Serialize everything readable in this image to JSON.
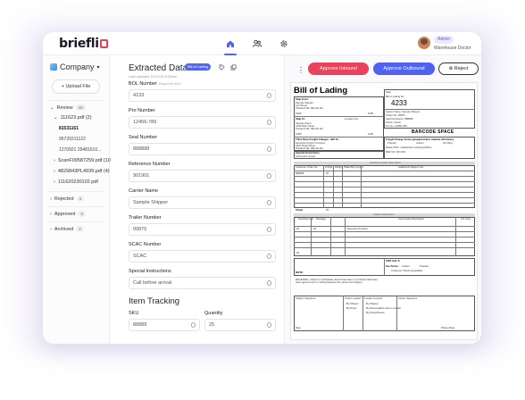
{
  "app": {
    "logo": "briefli",
    "user": {
      "role": "Admin",
      "name": "Warehouse Doctor"
    },
    "nav": {
      "home_icon": "home-icon",
      "users_icon": "users-icon",
      "settings_icon": "gear-icon"
    }
  },
  "sidebar": {
    "company": "Company",
    "upload_label": "+ Upload File",
    "review": {
      "label": "Review",
      "count": "10"
    },
    "review_items": [
      {
        "label": "111623.pdf (2)"
      },
      {
        "label": "81531161"
      },
      {
        "label": "95720211122"
      },
      {
        "label": "1270921 29481610..."
      },
      {
        "label": "ScanF09587259.pdf (10)"
      },
      {
        "label": "4829843PL4939.pdf (4)"
      },
      {
        "label": "111620230102.pdf"
      }
    ],
    "rejected": {
      "label": "Rejected",
      "count": "4"
    },
    "approved": {
      "label": "Approved",
      "count": "3"
    },
    "archived": {
      "label": "Archived",
      "count": "0"
    }
  },
  "form": {
    "title": "Extracted Data",
    "badge": "Bill of Lading",
    "subtitle": "Last updated 11/12/23 8:35am",
    "fields": [
      {
        "label": "BOL Number",
        "hint": "Required field",
        "value": "4233"
      },
      {
        "label": "Pro Number",
        "hint": "",
        "value": "12456-789"
      },
      {
        "label": "Seal Number",
        "hint": "",
        "value": "888888"
      },
      {
        "label": "Reference Number",
        "hint": "",
        "value": "901901"
      },
      {
        "label": "Carrier Name",
        "hint": "",
        "value": "Sample Shipper"
      },
      {
        "label": "Trailer Number",
        "hint": "",
        "value": "09875"
      },
      {
        "label": "SCAC Number",
        "hint": "",
        "value": "SCAC"
      },
      {
        "label": "Special Instructions",
        "hint": "",
        "value": "Call before arrival"
      }
    ],
    "item_tracking": {
      "title": "Item Tracking",
      "sku_label": "SKU",
      "sku_value": "88888",
      "qty_label": "Quantity",
      "qty_value": "25"
    }
  },
  "actions": {
    "approve_inbound": "Approve Inbound",
    "approve_outbound": "Approve Outbound",
    "reject": "Reject"
  },
  "document": {
    "title": "Bill of Lading",
    "bol_number_label": "Bill of Lading No:",
    "bol_number": "4233",
    "carrier": "Carrier Name: Sample Shipper",
    "trailer": "Trailer No: 09875",
    "seal": "Seal Number(s): 888888",
    "scac": "SCAC: SCAC",
    "pro": "Pro No: 12456-789",
    "barcode_space": "BARCODE SPACE",
    "ship_from": "Ship From:",
    "ship_from_lines": [
      "Sample Shipper",
      "123 Street",
      "Portland OR, 991-66-111"
    ],
    "ship_to": "Ship To:",
    "ship_to_lines": [
      "Sample Client",
      "1234 Main Street",
      "Portland OR, 991-66-111"
    ],
    "location_no": "Location No:",
    "fob": "FOB",
    "third_party": "Third Party Freight Charges - Bill To:",
    "third_party_lines": [
      "Example Freight Company",
      "4321 Road Street",
      "Portland OR, 991-66-111"
    ],
    "special_instructions": "Special Instructions:",
    "special_value": "Call before arrival",
    "freight_terms": "Freight Charge Terms (prepaid unless marked otherwise)",
    "freight_options": [
      "Prepaid",
      "Collect",
      "3rd Party"
    ],
    "master_bol": "Master BOL: w/attached underlying BOLs",
    "ref_no": "REF NO: 901 901",
    "customer_order": "Customer Order Information",
    "order_headers": [
      "Customer Order No.",
      "# Pkgs",
      "Weight",
      "Pallet/Slip (circle)",
      "Additional Shipper Info"
    ],
    "order_row": [
      "888888",
      "25"
    ],
    "totals_label": "Totals",
    "totals_pkgs": "25",
    "carrier_info": "Carrier Information",
    "handling_unit": "Handling Unit",
    "package": "Package",
    "commodity": "Commodity Description",
    "ltl_only": "LTL Only",
    "carrier_row": [
      "25",
      "25",
      "Example Products"
    ],
    "carrier_totals": "25",
    "cod_amount": "COD Amt: $",
    "fee_terms": "Fee Terms:",
    "fee_options": [
      "Collect",
      "Prepaid",
      "Customer Check Acceptable"
    ],
    "note_label": "NOTE:",
    "received": "RECEIVED, subject to individually determined rates or contracts that have been agreed upon in writing between the carrier and shipper.",
    "shipper_signature": "Shipper Signature",
    "carrier_signature": "Carrier Signature",
    "date_label": "Date",
    "pickup_date": "Pickup Date",
    "trailer_loaded": "Trailer Loaded",
    "freight_counted": "Freight Counted",
    "loaded_options": [
      "By Shipper",
      "By Driver"
    ],
    "counted_options": [
      "By Shipper",
      "By Driver/pallets said to contain",
      "By Driver/Pieces"
    ]
  }
}
